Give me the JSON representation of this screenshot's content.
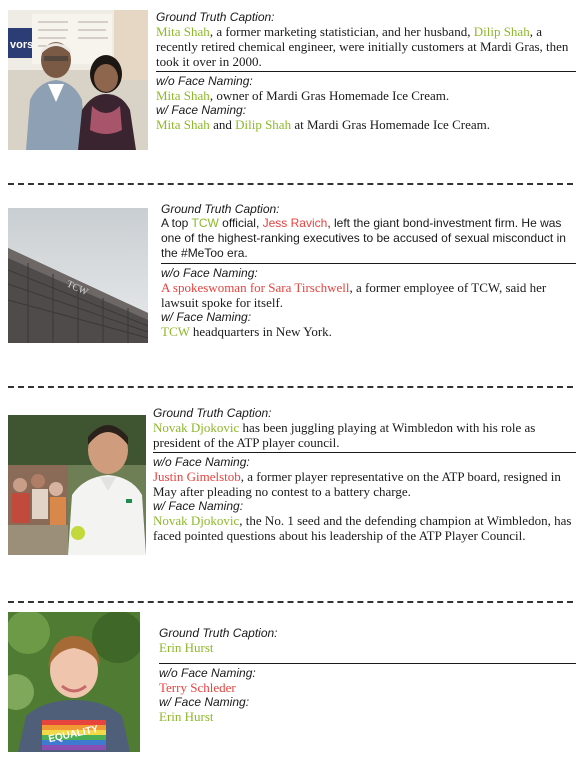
{
  "labels": {
    "gt": "Ground Truth Caption",
    "wo": "w/o Face Naming:",
    "w": "w/ Face Naming:"
  },
  "colors": {
    "correct": "#8db82a",
    "wrong": "#e8433e"
  },
  "examples": [
    {
      "gt": [
        "Mita Shah",
        ", a former marketing statistician, and her husband, ",
        "Dilip Shah",
        ", a recently retired chemical engineer, were initially customers at Mardi Gras, then took it over in 2000."
      ],
      "wo": [
        "Mita Shah",
        ", owner of Mardi Gras Homemade Ice Cream."
      ],
      "w": [
        "Mita Shah",
        " and ",
        "Dilip Shah",
        " at Mardi Gras Homemade Ice Cream."
      ]
    },
    {
      "gt": [
        "A top ",
        "TCW",
        " official, ",
        "Jess Ravich",
        ", left the giant bond-investment  firm. He was one of the highest-ranking executives to be accused of sexual misconduct in the #MeToo era."
      ],
      "wo": [
        "A spokeswoman for Sara Tirschwell",
        ", a former employee of TCW, said her lawsuit spoke for itself."
      ],
      "w": [
        "TCW",
        " headquarters in New York."
      ]
    },
    {
      "gt": [
        "Novak Djokovic",
        " has been juggling playing at Wimbledon with his role as president of the ATP player council."
      ],
      "wo": [
        "Justin Gimelstob",
        ", a former player representative on the ATP board, resigned in May after pleading no contest to a battery charge."
      ],
      "w": [
        "Novak Djokovic",
        ", the No. 1 seed and the defending champion at Wimbledon, has faced pointed questions about his leadership of the ATP Player Council."
      ]
    },
    {
      "gt": [
        "Erin Hurst"
      ],
      "wo": [
        "Terry Schleder"
      ],
      "w": [
        "Erin Hurst"
      ]
    }
  ],
  "images": {
    "img1": {
      "sign_text": "vors"
    },
    "img2": {
      "building_text": "TCW"
    },
    "img4": {
      "shirt_text": "EQUALITY"
    }
  }
}
